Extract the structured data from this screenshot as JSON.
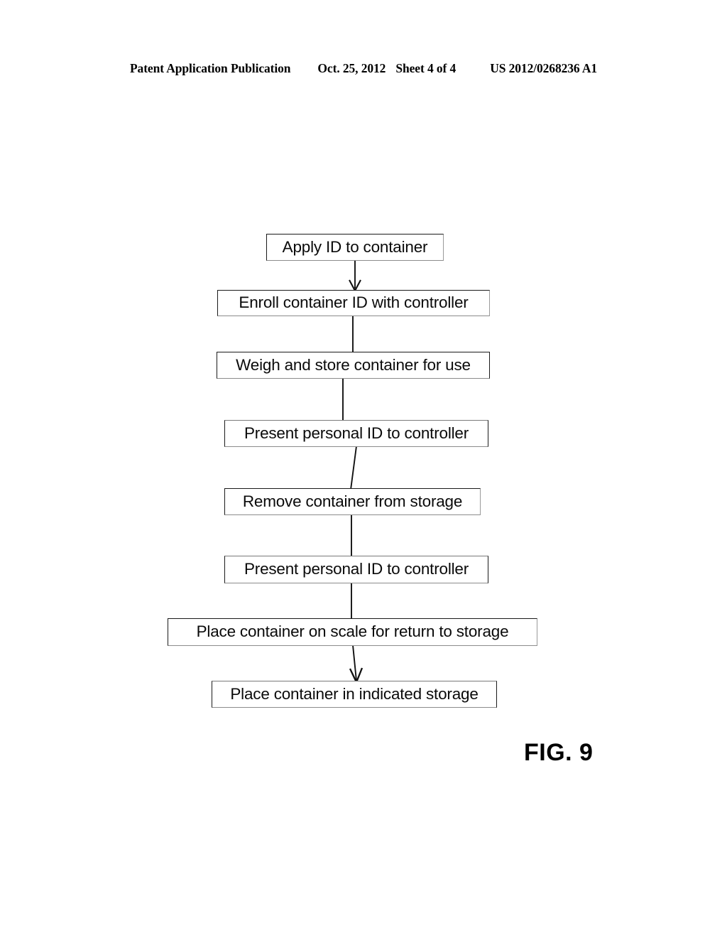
{
  "header": {
    "publication": "Patent Application Publication",
    "date": "Oct. 25, 2012",
    "sheet": "Sheet 4 of 4",
    "patent_number": "US 2012/0268236 A1"
  },
  "figure": {
    "caption": "FIG. 9",
    "steps": [
      {
        "id": "step-1",
        "label": "Apply ID to container"
      },
      {
        "id": "step-2",
        "label": "Enroll container ID with controller"
      },
      {
        "id": "step-3",
        "label": "Weigh and store container for use"
      },
      {
        "id": "step-4",
        "label": "Present personal ID to controller"
      },
      {
        "id": "step-5",
        "label": "Remove container from storage"
      },
      {
        "id": "step-6",
        "label": "Present personal ID to controller"
      },
      {
        "id": "step-7",
        "label": "Place container on scale for return to storage"
      },
      {
        "id": "step-8",
        "label": "Place container in indicated storage"
      }
    ],
    "connectors": [
      {
        "from": "step-1",
        "to": "step-2",
        "arrowhead": true
      },
      {
        "from": "step-2",
        "to": "step-3",
        "arrowhead": false
      },
      {
        "from": "step-3",
        "to": "step-4",
        "arrowhead": false
      },
      {
        "from": "step-4",
        "to": "step-5",
        "arrowhead": false
      },
      {
        "from": "step-5",
        "to": "step-6",
        "arrowhead": false
      },
      {
        "from": "step-6",
        "to": "step-7",
        "arrowhead": false
      },
      {
        "from": "step-7",
        "to": "step-8",
        "arrowhead": true
      }
    ]
  },
  "colors": {
    "page_background": "#ffffff",
    "ink": "#0a0a0a",
    "box_border": "#1a1a1a",
    "connector": "#111111"
  }
}
